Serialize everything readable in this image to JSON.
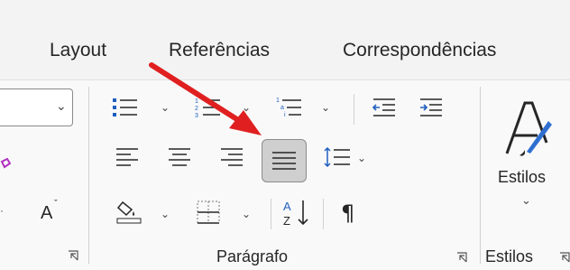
{
  "tabs": [
    {
      "label": "Layout"
    },
    {
      "label": "Referências"
    },
    {
      "label": "Correspondências"
    }
  ],
  "groups": {
    "paragraph_label": "Parágrafo",
    "styles_label": "Estilos",
    "styles_group_label": "Estilos"
  },
  "font_group": {
    "font_size_grow_label": "A"
  },
  "colors": {
    "accent_blue": "#1f5fbf",
    "arrow_red": "#e02020",
    "justify_bg": "#cfcfcf"
  }
}
